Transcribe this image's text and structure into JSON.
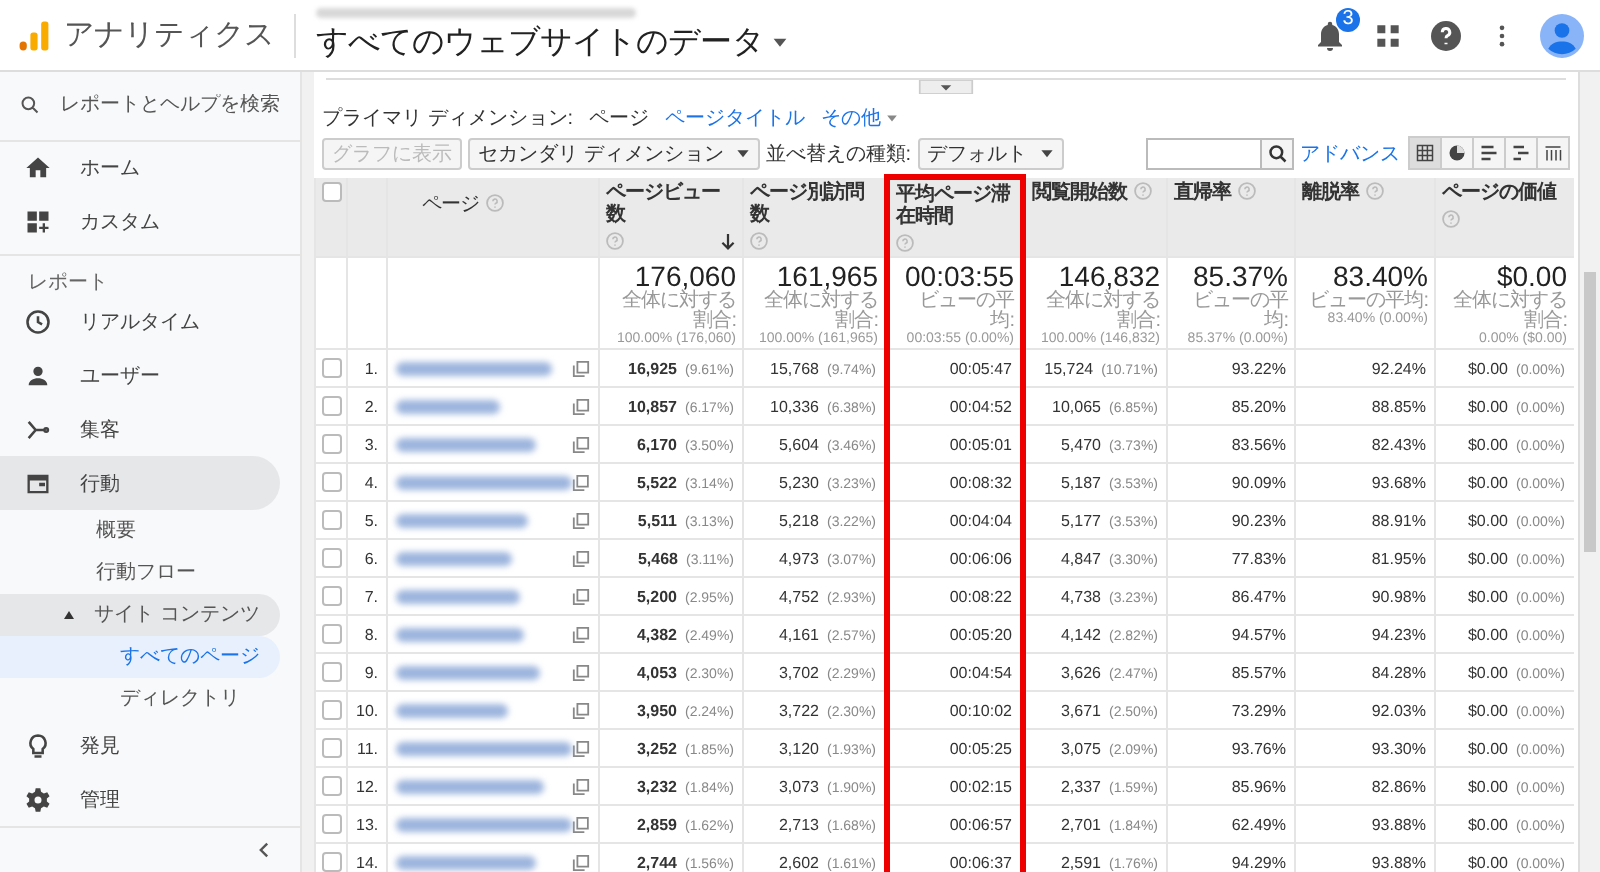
{
  "header": {
    "app_name": "アナリティクス",
    "property": "すべてのウェブサイトのデータ",
    "notifications": "3"
  },
  "sidebar": {
    "search": {
      "placeholder": "レポートとヘルプを検索"
    },
    "items": [
      {
        "kind": "link",
        "label": "ホーム",
        "selected": false
      },
      {
        "kind": "link",
        "label": "カスタム",
        "selected": false
      },
      {
        "kind": "section",
        "label": "レポート"
      },
      {
        "kind": "link",
        "label": "リアルタイム",
        "selected": false
      },
      {
        "kind": "link",
        "label": "ユーザー",
        "selected": false
      },
      {
        "kind": "link",
        "label": "集客",
        "selected": false
      },
      {
        "kind": "group",
        "label": "行動",
        "expanded": true,
        "children": [
          {
            "label": "概要",
            "selected": false
          },
          {
            "label": "行動フロー",
            "selected": false
          },
          {
            "label": "サイト コンテンツ",
            "expanded": true,
            "children": [
              {
                "label": "すべてのページ",
                "selected": true
              },
              {
                "label": "ディレクトリ",
                "selected": false
              }
            ]
          }
        ]
      },
      {
        "kind": "link",
        "label": "発見",
        "selected": false
      },
      {
        "kind": "link",
        "label": "管理",
        "selected": false
      }
    ]
  },
  "dimension_bar": {
    "label": "プライマリ ディメンション:",
    "options": [
      {
        "label": "ページ",
        "selected": true
      },
      {
        "label": "ページタイトル",
        "selected": false
      },
      {
        "label": "その他",
        "selected": false
      }
    ]
  },
  "toolbar": {
    "chart_button": {
      "label": "グラフに表示",
      "disabled": true
    },
    "secondary_dimension": "セカンダリ ディメンション",
    "sort_label": "並べ替えの種類:",
    "sort_value": "デフォルト",
    "advanced_link": "アドバンス",
    "views": [
      {
        "selected": true
      },
      {
        "selected": false
      },
      {
        "selected": false
      },
      {
        "selected": false
      },
      {
        "selected": false
      }
    ]
  },
  "table": {
    "select_all": {
      "checked": false
    },
    "page_column": {
      "label": "ページ"
    },
    "columns": [
      {
        "label": "ページビュー数",
        "sorted": true,
        "highlighted": false
      },
      {
        "label": "ページ別訪問数",
        "sorted": false,
        "highlighted": false
      },
      {
        "label": "平均ページ滞在時間",
        "sorted": false,
        "highlighted": true
      },
      {
        "label": "閲覧開始数",
        "sorted": false,
        "highlighted": false
      },
      {
        "label": "直帰率",
        "sorted": false,
        "highlighted": false
      },
      {
        "label": "離脱率",
        "sorted": false,
        "highlighted": false
      },
      {
        "label": "ページの価値",
        "sorted": false,
        "highlighted": false
      }
    ],
    "totals": [
      {
        "value": "176,060",
        "caption": "全体に対する割合:",
        "detail": "100.00% (176,060)"
      },
      {
        "value": "161,965",
        "caption": "全体に対する割合:",
        "detail": "100.00% (161,965)"
      },
      {
        "value": "00:03:55",
        "caption": "ビューの平均:",
        "detail": "00:03:55 (0.00%)"
      },
      {
        "value": "146,832",
        "caption": "全体に対する割合:",
        "detail": "100.00% (146,832)"
      },
      {
        "value": "85.37%",
        "caption": "ビューの平均:",
        "detail": "85.37% (0.00%)"
      },
      {
        "value": "83.40%",
        "caption": "ビューの平均:",
        "detail": "83.40% (0.00%)"
      },
      {
        "value": "$0.00",
        "caption": "全体に対する割合:",
        "detail": "0.00% ($0.00)"
      }
    ],
    "rows": [
      {
        "number": "1.",
        "checked": false,
        "cells": [
          {
            "value": "16,925",
            "share": "(9.61%)"
          },
          {
            "value": "15,768",
            "share": "(9.74%)"
          },
          {
            "value": "00:05:47"
          },
          {
            "value": "15,724",
            "share": "(10.71%)"
          },
          {
            "value": "93.22%"
          },
          {
            "value": "92.24%"
          },
          {
            "value": "$0.00",
            "share": "(0.00%)"
          }
        ]
      },
      {
        "number": "2.",
        "checked": false,
        "cells": [
          {
            "value": "10,857",
            "share": "(6.17%)"
          },
          {
            "value": "10,336",
            "share": "(6.38%)"
          },
          {
            "value": "00:04:52"
          },
          {
            "value": "10,065",
            "share": "(6.85%)"
          },
          {
            "value": "85.20%"
          },
          {
            "value": "88.85%"
          },
          {
            "value": "$0.00",
            "share": "(0.00%)"
          }
        ]
      },
      {
        "number": "3.",
        "checked": false,
        "cells": [
          {
            "value": "6,170",
            "share": "(3.50%)"
          },
          {
            "value": "5,604",
            "share": "(3.46%)"
          },
          {
            "value": "00:05:01"
          },
          {
            "value": "5,470",
            "share": "(3.73%)"
          },
          {
            "value": "83.56%"
          },
          {
            "value": "82.43%"
          },
          {
            "value": "$0.00",
            "share": "(0.00%)"
          }
        ]
      },
      {
        "number": "4.",
        "checked": false,
        "cells": [
          {
            "value": "5,522",
            "share": "(3.14%)"
          },
          {
            "value": "5,230",
            "share": "(3.23%)"
          },
          {
            "value": "00:08:32"
          },
          {
            "value": "5,187",
            "share": "(3.53%)"
          },
          {
            "value": "90.09%"
          },
          {
            "value": "93.68%"
          },
          {
            "value": "$0.00",
            "share": "(0.00%)"
          }
        ]
      },
      {
        "number": "5.",
        "checked": false,
        "cells": [
          {
            "value": "5,511",
            "share": "(3.13%)"
          },
          {
            "value": "5,218",
            "share": "(3.22%)"
          },
          {
            "value": "00:04:04"
          },
          {
            "value": "5,177",
            "share": "(3.53%)"
          },
          {
            "value": "90.23%"
          },
          {
            "value": "88.91%"
          },
          {
            "value": "$0.00",
            "share": "(0.00%)"
          }
        ]
      },
      {
        "number": "6.",
        "checked": false,
        "cells": [
          {
            "value": "5,468",
            "share": "(3.11%)"
          },
          {
            "value": "4,973",
            "share": "(3.07%)"
          },
          {
            "value": "00:06:06"
          },
          {
            "value": "4,847",
            "share": "(3.30%)"
          },
          {
            "value": "77.83%"
          },
          {
            "value": "81.95%"
          },
          {
            "value": "$0.00",
            "share": "(0.00%)"
          }
        ]
      },
      {
        "number": "7.",
        "checked": false,
        "cells": [
          {
            "value": "5,200",
            "share": "(2.95%)"
          },
          {
            "value": "4,752",
            "share": "(2.93%)"
          },
          {
            "value": "00:08:22"
          },
          {
            "value": "4,738",
            "share": "(3.23%)"
          },
          {
            "value": "86.47%"
          },
          {
            "value": "90.98%"
          },
          {
            "value": "$0.00",
            "share": "(0.00%)"
          }
        ]
      },
      {
        "number": "8.",
        "checked": false,
        "cells": [
          {
            "value": "4,382",
            "share": "(2.49%)"
          },
          {
            "value": "4,161",
            "share": "(2.57%)"
          },
          {
            "value": "00:05:20"
          },
          {
            "value": "4,142",
            "share": "(2.82%)"
          },
          {
            "value": "94.57%"
          },
          {
            "value": "94.23%"
          },
          {
            "value": "$0.00",
            "share": "(0.00%)"
          }
        ]
      },
      {
        "number": "9.",
        "checked": false,
        "cells": [
          {
            "value": "4,053",
            "share": "(2.30%)"
          },
          {
            "value": "3,702",
            "share": "(2.29%)"
          },
          {
            "value": "00:04:54"
          },
          {
            "value": "3,626",
            "share": "(2.47%)"
          },
          {
            "value": "85.57%"
          },
          {
            "value": "84.28%"
          },
          {
            "value": "$0.00",
            "share": "(0.00%)"
          }
        ]
      },
      {
        "number": "10.",
        "checked": false,
        "cells": [
          {
            "value": "3,950",
            "share": "(2.24%)"
          },
          {
            "value": "3,722",
            "share": "(2.30%)"
          },
          {
            "value": "00:10:02"
          },
          {
            "value": "3,671",
            "share": "(2.50%)"
          },
          {
            "value": "73.29%"
          },
          {
            "value": "92.03%"
          },
          {
            "value": "$0.00",
            "share": "(0.00%)"
          }
        ]
      },
      {
        "number": "11.",
        "checked": false,
        "cells": [
          {
            "value": "3,252",
            "share": "(1.85%)"
          },
          {
            "value": "3,120",
            "share": "(1.93%)"
          },
          {
            "value": "00:05:25"
          },
          {
            "value": "3,075",
            "share": "(2.09%)"
          },
          {
            "value": "93.76%"
          },
          {
            "value": "93.30%"
          },
          {
            "value": "$0.00",
            "share": "(0.00%)"
          }
        ]
      },
      {
        "number": "12.",
        "checked": false,
        "cells": [
          {
            "value": "3,232",
            "share": "(1.84%)"
          },
          {
            "value": "3,073",
            "share": "(1.90%)"
          },
          {
            "value": "00:02:15"
          },
          {
            "value": "2,337",
            "share": "(1.59%)"
          },
          {
            "value": "85.96%"
          },
          {
            "value": "82.86%"
          },
          {
            "value": "$0.00",
            "share": "(0.00%)"
          }
        ]
      },
      {
        "number": "13.",
        "checked": false,
        "cells": [
          {
            "value": "2,859",
            "share": "(1.62%)"
          },
          {
            "value": "2,713",
            "share": "(1.68%)"
          },
          {
            "value": "00:06:57"
          },
          {
            "value": "2,701",
            "share": "(1.84%)"
          },
          {
            "value": "62.49%"
          },
          {
            "value": "93.88%"
          },
          {
            "value": "$0.00",
            "share": "(0.00%)"
          }
        ]
      },
      {
        "number": "14.",
        "checked": false,
        "cells": [
          {
            "value": "2,744",
            "share": "(1.56%)"
          },
          {
            "value": "2,602",
            "share": "(1.61%)"
          },
          {
            "value": "00:06:37"
          },
          {
            "value": "2,591",
            "share": "(1.76%)"
          },
          {
            "value": "94.29%"
          },
          {
            "value": "93.88%"
          },
          {
            "value": "$0.00",
            "share": "(0.00%)"
          }
        ]
      }
    ]
  }
}
